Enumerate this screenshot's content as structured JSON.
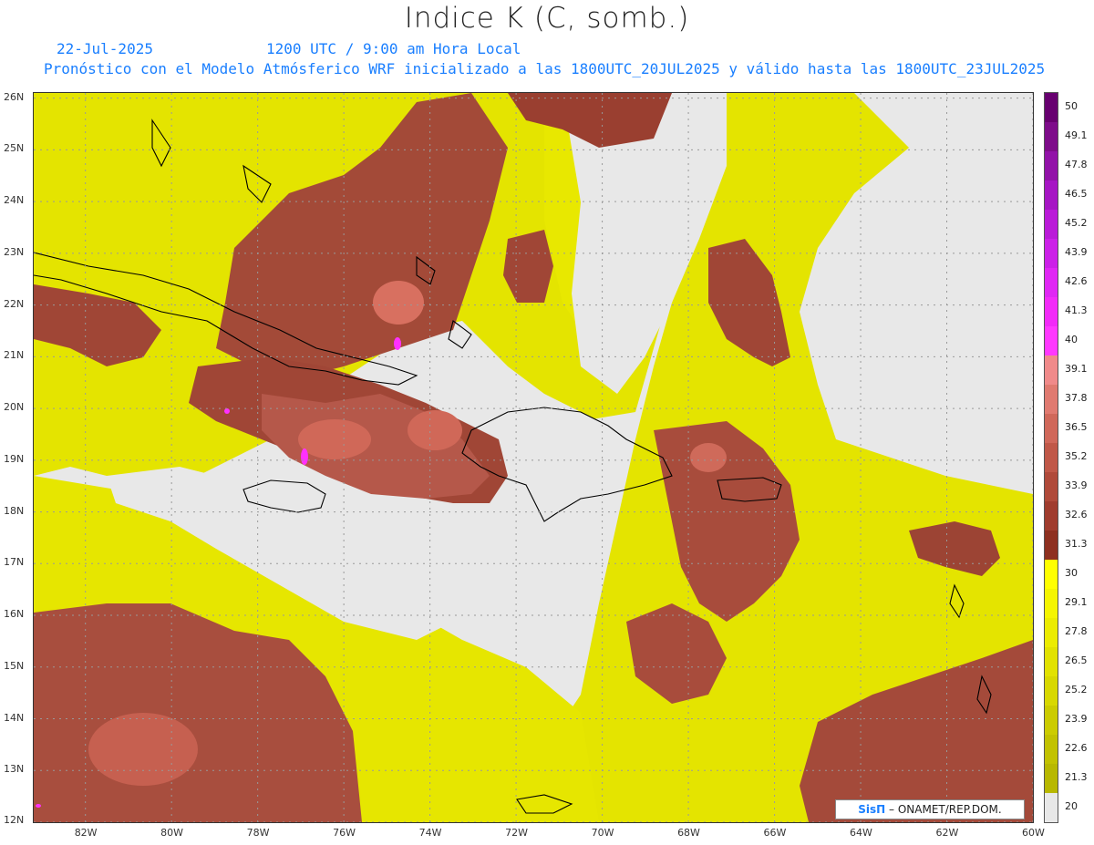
{
  "title": "Indice K (C, somb.)",
  "header": {
    "date": "22-Jul-2025",
    "time": "1200 UTC / 9:00 am Hora Local",
    "forecast": "Pronóstico con el Modelo Atmósferico WRF inicializado a las 1800UTC_20JUL2025 y válido hasta las  1800UTC_23JUL2025"
  },
  "map": {
    "lat_labels": [
      "26N",
      "25N",
      "24N",
      "23N",
      "22N",
      "21N",
      "20N",
      "19N",
      "18N",
      "17N",
      "16N",
      "15N",
      "14N",
      "13N",
      "12N"
    ],
    "lon_labels": [
      "82W",
      "80W",
      "78W",
      "76W",
      "74W",
      "72W",
      "70W",
      "68W",
      "66W",
      "64W",
      "62W",
      "60W"
    ],
    "lon_range": [
      -83.2,
      -60
    ],
    "lat_range": [
      12,
      26.1
    ],
    "background_color": "#e8e8e8"
  },
  "colorbar": {
    "labels": [
      "50",
      "49.1",
      "47.8",
      "46.5",
      "45.2",
      "43.9",
      "42.6",
      "41.3",
      "40",
      "39.1",
      "37.8",
      "36.5",
      "35.2",
      "33.9",
      "32.6",
      "31.3",
      "30",
      "29.1",
      "27.8",
      "26.5",
      "25.2",
      "23.9",
      "22.6",
      "21.3",
      "20"
    ],
    "colors": [
      "#680070",
      "#7e0c8a",
      "#9212a8",
      "#a616c4",
      "#ba1ad8",
      "#cc20e8",
      "#e026f4",
      "#f22af8",
      "#ff38ff",
      "#f08a8a",
      "#e07a70",
      "#d0685a",
      "#c05848",
      "#b04a3a",
      "#a03c2e",
      "#8e3020",
      "#ffff00",
      "#f5f500",
      "#ecec00",
      "#e2e200",
      "#d8d800",
      "#cccc00",
      "#c2c200",
      "#b8b800",
      "#e8e8e8"
    ]
  },
  "logo": {
    "brand": "SisΠ",
    "text": " – ONAMET/REP.DOM."
  }
}
